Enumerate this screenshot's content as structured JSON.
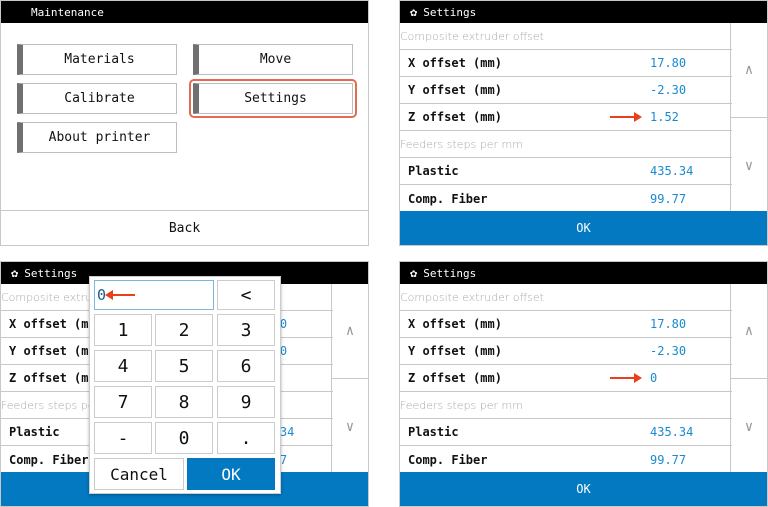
{
  "panel1": {
    "title": "Maintenance",
    "buttons": [
      "Materials",
      "Move",
      "Calibrate",
      "Settings",
      "About printer"
    ],
    "back": "Back"
  },
  "settings": {
    "title": "Settings",
    "section1": "Composite extruder offset",
    "section2": "Feeders steps per mm",
    "rows": [
      {
        "label": "X offset (mm)",
        "value": "17.80"
      },
      {
        "label": "Y offset (mm)",
        "value": "-2.30"
      },
      {
        "label": "Z offset (mm)",
        "value": "1.52"
      },
      {
        "label": "Plastic",
        "value": "435.34"
      },
      {
        "label": "Comp. Fiber",
        "value": "99.77"
      }
    ],
    "z_after": "0",
    "ok": "OK",
    "up": "^",
    "down": "v"
  },
  "keypad": {
    "input": "0",
    "backspace": "<",
    "keys": [
      "1",
      "2",
      "3",
      "4",
      "5",
      "6",
      "7",
      "8",
      "9",
      "-",
      "0",
      "."
    ],
    "cancel": "Cancel",
    "ok": "OK"
  },
  "colors": {
    "accent": "#0279c1",
    "value": "#1a8ad0",
    "highlight": "#e8401c"
  }
}
